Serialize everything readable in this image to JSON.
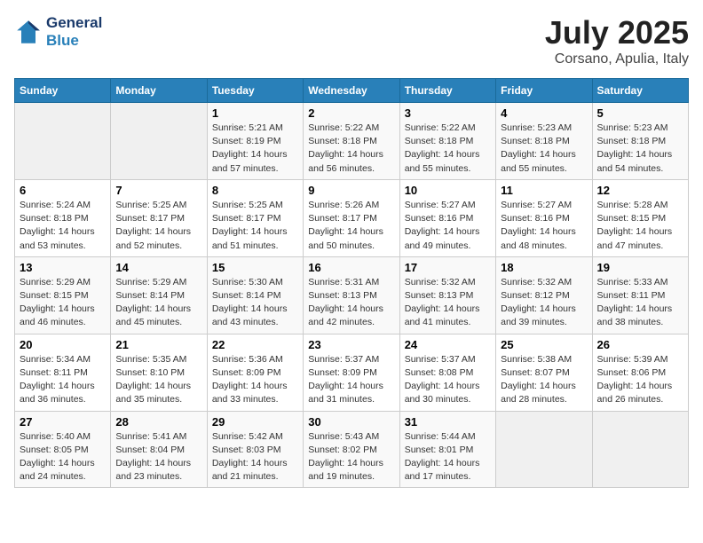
{
  "header": {
    "logo_line1": "General",
    "logo_line2": "Blue",
    "month": "July 2025",
    "location": "Corsano, Apulia, Italy"
  },
  "weekdays": [
    "Sunday",
    "Monday",
    "Tuesday",
    "Wednesday",
    "Thursday",
    "Friday",
    "Saturday"
  ],
  "weeks": [
    [
      {
        "day": "",
        "sunrise": "",
        "sunset": "",
        "daylight": ""
      },
      {
        "day": "",
        "sunrise": "",
        "sunset": "",
        "daylight": ""
      },
      {
        "day": "1",
        "sunrise": "Sunrise: 5:21 AM",
        "sunset": "Sunset: 8:19 PM",
        "daylight": "Daylight: 14 hours and 57 minutes."
      },
      {
        "day": "2",
        "sunrise": "Sunrise: 5:22 AM",
        "sunset": "Sunset: 8:18 PM",
        "daylight": "Daylight: 14 hours and 56 minutes."
      },
      {
        "day": "3",
        "sunrise": "Sunrise: 5:22 AM",
        "sunset": "Sunset: 8:18 PM",
        "daylight": "Daylight: 14 hours and 55 minutes."
      },
      {
        "day": "4",
        "sunrise": "Sunrise: 5:23 AM",
        "sunset": "Sunset: 8:18 PM",
        "daylight": "Daylight: 14 hours and 55 minutes."
      },
      {
        "day": "5",
        "sunrise": "Sunrise: 5:23 AM",
        "sunset": "Sunset: 8:18 PM",
        "daylight": "Daylight: 14 hours and 54 minutes."
      }
    ],
    [
      {
        "day": "6",
        "sunrise": "Sunrise: 5:24 AM",
        "sunset": "Sunset: 8:18 PM",
        "daylight": "Daylight: 14 hours and 53 minutes."
      },
      {
        "day": "7",
        "sunrise": "Sunrise: 5:25 AM",
        "sunset": "Sunset: 8:17 PM",
        "daylight": "Daylight: 14 hours and 52 minutes."
      },
      {
        "day": "8",
        "sunrise": "Sunrise: 5:25 AM",
        "sunset": "Sunset: 8:17 PM",
        "daylight": "Daylight: 14 hours and 51 minutes."
      },
      {
        "day": "9",
        "sunrise": "Sunrise: 5:26 AM",
        "sunset": "Sunset: 8:17 PM",
        "daylight": "Daylight: 14 hours and 50 minutes."
      },
      {
        "day": "10",
        "sunrise": "Sunrise: 5:27 AM",
        "sunset": "Sunset: 8:16 PM",
        "daylight": "Daylight: 14 hours and 49 minutes."
      },
      {
        "day": "11",
        "sunrise": "Sunrise: 5:27 AM",
        "sunset": "Sunset: 8:16 PM",
        "daylight": "Daylight: 14 hours and 48 minutes."
      },
      {
        "day": "12",
        "sunrise": "Sunrise: 5:28 AM",
        "sunset": "Sunset: 8:15 PM",
        "daylight": "Daylight: 14 hours and 47 minutes."
      }
    ],
    [
      {
        "day": "13",
        "sunrise": "Sunrise: 5:29 AM",
        "sunset": "Sunset: 8:15 PM",
        "daylight": "Daylight: 14 hours and 46 minutes."
      },
      {
        "day": "14",
        "sunrise": "Sunrise: 5:29 AM",
        "sunset": "Sunset: 8:14 PM",
        "daylight": "Daylight: 14 hours and 45 minutes."
      },
      {
        "day": "15",
        "sunrise": "Sunrise: 5:30 AM",
        "sunset": "Sunset: 8:14 PM",
        "daylight": "Daylight: 14 hours and 43 minutes."
      },
      {
        "day": "16",
        "sunrise": "Sunrise: 5:31 AM",
        "sunset": "Sunset: 8:13 PM",
        "daylight": "Daylight: 14 hours and 42 minutes."
      },
      {
        "day": "17",
        "sunrise": "Sunrise: 5:32 AM",
        "sunset": "Sunset: 8:13 PM",
        "daylight": "Daylight: 14 hours and 41 minutes."
      },
      {
        "day": "18",
        "sunrise": "Sunrise: 5:32 AM",
        "sunset": "Sunset: 8:12 PM",
        "daylight": "Daylight: 14 hours and 39 minutes."
      },
      {
        "day": "19",
        "sunrise": "Sunrise: 5:33 AM",
        "sunset": "Sunset: 8:11 PM",
        "daylight": "Daylight: 14 hours and 38 minutes."
      }
    ],
    [
      {
        "day": "20",
        "sunrise": "Sunrise: 5:34 AM",
        "sunset": "Sunset: 8:11 PM",
        "daylight": "Daylight: 14 hours and 36 minutes."
      },
      {
        "day": "21",
        "sunrise": "Sunrise: 5:35 AM",
        "sunset": "Sunset: 8:10 PM",
        "daylight": "Daylight: 14 hours and 35 minutes."
      },
      {
        "day": "22",
        "sunrise": "Sunrise: 5:36 AM",
        "sunset": "Sunset: 8:09 PM",
        "daylight": "Daylight: 14 hours and 33 minutes."
      },
      {
        "day": "23",
        "sunrise": "Sunrise: 5:37 AM",
        "sunset": "Sunset: 8:09 PM",
        "daylight": "Daylight: 14 hours and 31 minutes."
      },
      {
        "day": "24",
        "sunrise": "Sunrise: 5:37 AM",
        "sunset": "Sunset: 8:08 PM",
        "daylight": "Daylight: 14 hours and 30 minutes."
      },
      {
        "day": "25",
        "sunrise": "Sunrise: 5:38 AM",
        "sunset": "Sunset: 8:07 PM",
        "daylight": "Daylight: 14 hours and 28 minutes."
      },
      {
        "day": "26",
        "sunrise": "Sunrise: 5:39 AM",
        "sunset": "Sunset: 8:06 PM",
        "daylight": "Daylight: 14 hours and 26 minutes."
      }
    ],
    [
      {
        "day": "27",
        "sunrise": "Sunrise: 5:40 AM",
        "sunset": "Sunset: 8:05 PM",
        "daylight": "Daylight: 14 hours and 24 minutes."
      },
      {
        "day": "28",
        "sunrise": "Sunrise: 5:41 AM",
        "sunset": "Sunset: 8:04 PM",
        "daylight": "Daylight: 14 hours and 23 minutes."
      },
      {
        "day": "29",
        "sunrise": "Sunrise: 5:42 AM",
        "sunset": "Sunset: 8:03 PM",
        "daylight": "Daylight: 14 hours and 21 minutes."
      },
      {
        "day": "30",
        "sunrise": "Sunrise: 5:43 AM",
        "sunset": "Sunset: 8:02 PM",
        "daylight": "Daylight: 14 hours and 19 minutes."
      },
      {
        "day": "31",
        "sunrise": "Sunrise: 5:44 AM",
        "sunset": "Sunset: 8:01 PM",
        "daylight": "Daylight: 14 hours and 17 minutes."
      },
      {
        "day": "",
        "sunrise": "",
        "sunset": "",
        "daylight": ""
      },
      {
        "day": "",
        "sunrise": "",
        "sunset": "",
        "daylight": ""
      }
    ]
  ]
}
